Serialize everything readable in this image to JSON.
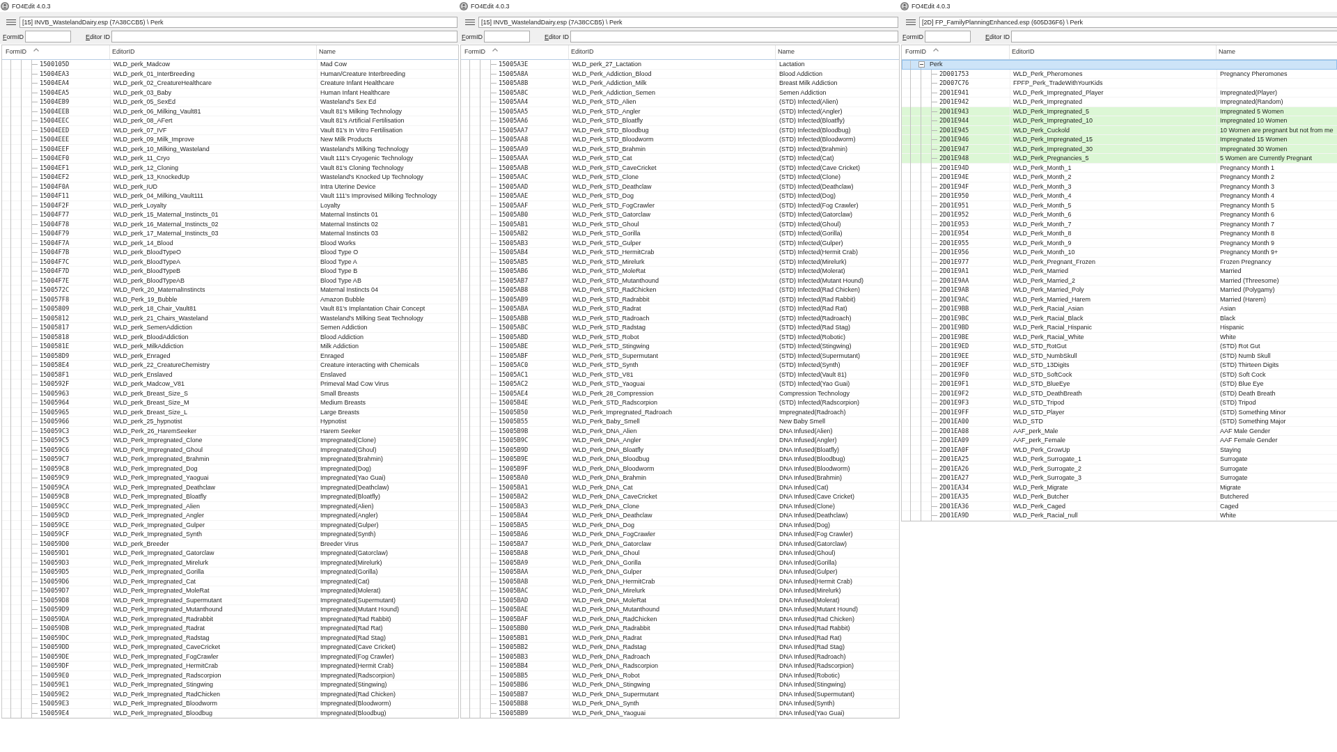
{
  "windows": [
    {
      "title": "FO4Edit 4.0.3",
      "path": "[15] INVB_WastelandDairy.esp (7A38CCB5) \\ Perk",
      "filters": [
        {
          "label": "FormID"
        },
        {
          "label": "Editor ID"
        }
      ],
      "columns": [
        {
          "label": "FormID",
          "sorted": true
        },
        {
          "label": "EditorID",
          "sorted": false
        },
        {
          "label": "Name",
          "sorted": false
        }
      ],
      "tree": [
        {
          "cells": [
            "1500105D",
            "WLD_perk_Madcow",
            "Mad Cow"
          ],
          "selected": false
        },
        {
          "cells": [
            "15004EA3",
            "WLD_perk_01_InterBreeding",
            "Human/Creature Interbreeding"
          ],
          "selected": false
        },
        {
          "cells": [
            "15004EA4",
            "WLD_perk_02_CreatureHealthcare",
            "Creature Infant Healthcare"
          ],
          "selected": false
        },
        {
          "cells": [
            "15004EA5",
            "WLD_perk_03_Baby",
            "Human Infant Healthcare"
          ],
          "selected": false
        },
        {
          "cells": [
            "15004EB9",
            "WLD_perk_05_SexEd",
            "Wasteland's Sex Ed"
          ],
          "selected": false
        },
        {
          "cells": [
            "15004EEB",
            "WLD_perk_06_Milking_Vault81",
            "Vault 81's Milking Technology"
          ],
          "selected": false
        },
        {
          "cells": [
            "15004EEC",
            "WLD_perk_08_AFert",
            "Vault 81's Artificial Fertilisation"
          ],
          "selected": false
        },
        {
          "cells": [
            "15004EED",
            "WLD_perk_07_IVF",
            "Vault 81's In Vitro Fertilisation"
          ],
          "selected": false
        },
        {
          "cells": [
            "15004EEE",
            "WLD_perk_09_Milk_Improve",
            "New Milk Products"
          ],
          "selected": false
        },
        {
          "cells": [
            "15004EEF",
            "WLD_perk_10_Milking_Wasteland",
            "Wasteland's Milking Technology"
          ],
          "selected": false
        },
        {
          "cells": [
            "15004EF0",
            "WLD_perk_11_Cryo",
            "Vault 111's Cryogenic Technology"
          ],
          "selected": false
        },
        {
          "cells": [
            "15004EF1",
            "WLD_perk_12_Cloning",
            "Vault 81's Cloning Technology"
          ],
          "selected": false
        },
        {
          "cells": [
            "15004EF2",
            "WLD_perk_13_KnockedUp",
            "Wasteland's Knocked Up Technology"
          ],
          "selected": false
        },
        {
          "cells": [
            "15004F0A",
            "WLD_perk_IUD",
            "Intra Uterine Device"
          ],
          "selected": false
        },
        {
          "cells": [
            "15004F11",
            "WLD_perk_04_Milking_Vault111",
            "Vault 111's Improvised Milking Technology"
          ],
          "selected": false
        },
        {
          "cells": [
            "15004F2F",
            "WLD_perk_Loyalty",
            "Loyalty"
          ],
          "selected": false
        },
        {
          "cells": [
            "15004F77",
            "WLD_perk_15_Maternal_Instincts_01",
            "Maternal Instincts 01"
          ],
          "selected": false
        },
        {
          "cells": [
            "15004F78",
            "WLD_perk_16_Maternal_Instincts_02",
            "Maternal Instincts 02"
          ],
          "selected": false
        },
        {
          "cells": [
            "15004F79",
            "WLD_perk_17_Maternal_Instincts_03",
            "Maternal Instincts 03"
          ],
          "selected": false
        },
        {
          "cells": [
            "15004F7A",
            "WLD_perk_14_Blood",
            "Blood Works"
          ],
          "selected": false
        },
        {
          "cells": [
            "15004F7B",
            "WLD_perk_BloodTypeO",
            "Blood Type O"
          ],
          "selected": false
        },
        {
          "cells": [
            "15004F7C",
            "WLD_perk_BloodTypeA",
            "Blood Type A"
          ],
          "selected": false
        },
        {
          "cells": [
            "15004F7D",
            "WLD_perk_BloodTypeB",
            "Blood Type B"
          ],
          "selected": false
        },
        {
          "cells": [
            "15004F7E",
            "WLD_perk_BloodTypeAB",
            "Blood Type AB"
          ],
          "selected": false
        },
        {
          "cells": [
            "1500572C",
            "WLD_Perk_20_MaternalInstincts",
            "Maternal Instincts 04"
          ],
          "selected": false
        },
        {
          "cells": [
            "150057F8",
            "WLD_Perk_19_Bubble",
            "Amazon Bubble"
          ],
          "selected": false
        },
        {
          "cells": [
            "15005809",
            "WLD_perk_18_Chair_Vault81",
            "Vault 81's Implantation Chair Concept"
          ],
          "selected": false
        },
        {
          "cells": [
            "15005812",
            "WLD_perk_21_Chairs_Wasteland",
            "Wasteland's Milking Seat Technology"
          ],
          "selected": false
        },
        {
          "cells": [
            "15005817",
            "WLD_perk_SemenAddiction",
            "Semen Addiction"
          ],
          "selected": false
        },
        {
          "cells": [
            "15005818",
            "WLD_perk_BloodAddiction",
            "Blood Addiction"
          ],
          "selected": false
        },
        {
          "cells": [
            "1500581E",
            "WLD_perk_MilkAddiction",
            "Milk Addiction"
          ],
          "selected": false
        },
        {
          "cells": [
            "150058D9",
            "WLD_perk_Enraged",
            "Enraged"
          ],
          "selected": false
        },
        {
          "cells": [
            "150058E4",
            "WLD_perk_22_CreatureChemistry",
            "Creature interacting with Chemicals"
          ],
          "selected": false
        },
        {
          "cells": [
            "150058F1",
            "WLD_perk_Enslaved",
            "Enslaved"
          ],
          "selected": false
        },
        {
          "cells": [
            "1500592F",
            "WLD_perk_Madcow_V81",
            "Primeval Mad Cow Virus"
          ],
          "selected": false
        },
        {
          "cells": [
            "15005963",
            "WLD_perk_Breast_Size_S",
            "Small Breasts"
          ],
          "selected": false
        },
        {
          "cells": [
            "15005964",
            "WLD_perk_Breast_Size_M",
            "Medium Breasts"
          ],
          "selected": false
        },
        {
          "cells": [
            "15005965",
            "WLD_perk_Breast_Size_L",
            "Large Breasts"
          ],
          "selected": false
        },
        {
          "cells": [
            "15005966",
            "WLD_perk_25_hypnotist",
            "Hypnotist"
          ],
          "selected": false
        },
        {
          "cells": [
            "150059C3",
            "WLD_Perk_26_HaremSeeker",
            "Harem Seeker"
          ],
          "selected": false
        },
        {
          "cells": [
            "150059C5",
            "WLD_Perk_Impregnated_Clone",
            "Impregnated(Clone)"
          ],
          "selected": false
        },
        {
          "cells": [
            "150059C6",
            "WLD_Perk_Impregnated_Ghoul",
            "Impregnated(Ghoul)"
          ],
          "selected": false
        },
        {
          "cells": [
            "150059C7",
            "WLD_Perk_Impregnated_Brahmin",
            "Impregnated(Brahmin)"
          ],
          "selected": false
        },
        {
          "cells": [
            "150059C8",
            "WLD_Perk_Impregnated_Dog",
            "Impregnated(Dog)"
          ],
          "selected": false
        },
        {
          "cells": [
            "150059C9",
            "WLD_Perk_Impregnated_Yaoguai",
            "Impregnated(Yao Guai)"
          ],
          "selected": false
        },
        {
          "cells": [
            "150059CA",
            "WLD_Perk_Impregnated_Deathclaw",
            "Impregnated(Deathclaw)"
          ],
          "selected": false
        },
        {
          "cells": [
            "150059CB",
            "WLD_Perk_Impregnated_Bloatfly",
            "Impregnated(Bloatfly)"
          ],
          "selected": false
        },
        {
          "cells": [
            "150059CC",
            "WLD_Perk_Impregnated_Alien",
            "Impregnated(Alien)"
          ],
          "selected": false
        },
        {
          "cells": [
            "150059CD",
            "WLD_Perk_Impregnated_Angler",
            "Impregnated(Angler)"
          ],
          "selected": false
        },
        {
          "cells": [
            "150059CE",
            "WLD_Perk_Impregnated_Gulper",
            "Impregnated(Gulper)"
          ],
          "selected": false
        },
        {
          "cells": [
            "150059CF",
            "WLD_Perk_Impregnated_Synth",
            "Impregnated(Synth)"
          ],
          "selected": false
        },
        {
          "cells": [
            "150059D0",
            "WLD_perk_Breeder",
            "Breeder Virus"
          ],
          "selected": false
        },
        {
          "cells": [
            "150059D1",
            "WLD_Perk_Impregnated_Gatorclaw",
            "Impregnated(Gatorclaw)"
          ],
          "selected": false
        },
        {
          "cells": [
            "150059D3",
            "WLD_Perk_Impregnated_Mirelurk",
            "Impregnated(Mirelurk)"
          ],
          "selected": false
        },
        {
          "cells": [
            "150059D5",
            "WLD_Perk_Impregnated_Gorilla",
            "Impregnated(Gorilla)"
          ],
          "selected": false
        },
        {
          "cells": [
            "150059D6",
            "WLD_Perk_Impregnated_Cat",
            "Impregnated(Cat)"
          ],
          "selected": false
        },
        {
          "cells": [
            "150059D7",
            "WLD_Perk_Impregnated_MoleRat",
            "Impregnated(Molerat)"
          ],
          "selected": false
        },
        {
          "cells": [
            "150059D8",
            "WLD_Perk_Impregnated_Supermutant",
            "Impregnated(Supermutant)"
          ],
          "selected": false
        },
        {
          "cells": [
            "150059D9",
            "WLD_Perk_Impregnated_Mutanthound",
            "Impregnated(Mutant Hound)"
          ],
          "selected": false
        },
        {
          "cells": [
            "150059DA",
            "WLD_Perk_Impregnated_Radrabbit",
            "Impregnated(Rad Rabbit)"
          ],
          "selected": false
        },
        {
          "cells": [
            "150059DB",
            "WLD_Perk_Impregnated_Radrat",
            "Impregnated(Rad Rat)"
          ],
          "selected": false
        },
        {
          "cells": [
            "150059DC",
            "WLD_Perk_Impregnated_Radstag",
            "Impregnated(Rad Stag)"
          ],
          "selected": false
        },
        {
          "cells": [
            "150059DD",
            "WLD_Perk_Impregnated_CaveCricket",
            "Impregnated(Cave Cricket)"
          ],
          "selected": false
        },
        {
          "cells": [
            "150059DE",
            "WLD_Perk_Impregnated_FogCrawler",
            "Impregnated(Fog Crawler)"
          ],
          "selected": false
        },
        {
          "cells": [
            "150059DF",
            "WLD_Perk_Impregnated_HermitCrab",
            "Impregnated(Hermit Crab)"
          ],
          "selected": false
        },
        {
          "cells": [
            "150059E0",
            "WLD_Perk_Impregnated_Radscorpion",
            "Impregnated(Radscorpion)"
          ],
          "selected": false
        },
        {
          "cells": [
            "150059E1",
            "WLD_Perk_Impregnated_Stingwing",
            "Impregnated(Stingwing)"
          ],
          "selected": false
        },
        {
          "cells": [
            "150059E2",
            "WLD_Perk_Impregnated_RadChicken",
            "Impregnated(Rad Chicken)"
          ],
          "selected": false
        },
        {
          "cells": [
            "150059E3",
            "WLD_Perk_Impregnated_Bloodworm",
            "Impregnated(Bloodworm)"
          ],
          "selected": false
        },
        {
          "cells": [
            "150059E4",
            "WLD_Perk_Impregnated_Bloodbug",
            "Impregnated(Bloodbug)"
          ],
          "selected": false
        }
      ]
    },
    {
      "title": "FO4Edit 4.0.3",
      "path": "[15] INVB_WastelandDairy.esp (7A38CCB5) \\ Perk",
      "filters": [
        {
          "label": "FormID"
        },
        {
          "label": "Editor ID"
        }
      ],
      "columns": [
        {
          "label": "FormID",
          "sorted": true
        },
        {
          "label": "EditorID",
          "sorted": false
        },
        {
          "label": "Name",
          "sorted": false
        }
      ],
      "tree": [
        {
          "cells": [
            "15005A3E",
            "WLD_perk_27_Lactation",
            "Lactation"
          ],
          "selected": false
        },
        {
          "cells": [
            "15005A8A",
            "WLD_Perk_Addiction_Blood",
            "Blood Addiction"
          ],
          "selected": false
        },
        {
          "cells": [
            "15005A8B",
            "WLD_Perk_Addiction_Milk",
            "Breast Milk Addiction"
          ],
          "selected": false
        },
        {
          "cells": [
            "15005A8C",
            "WLD_Perk_Addiction_Semen",
            "Semen Addiction"
          ],
          "selected": false
        },
        {
          "cells": [
            "15005AA4",
            "WLD_Perk_STD_Alien",
            "(STD) Infected(Alien)"
          ],
          "selected": false
        },
        {
          "cells": [
            "15005AA5",
            "WLD_Perk_STD_Angler",
            "(STD) Infected(Angler)"
          ],
          "selected": false
        },
        {
          "cells": [
            "15005AA6",
            "WLD_Perk_STD_Bloatfly",
            "(STD) Infected(Bloatfly)"
          ],
          "selected": false
        },
        {
          "cells": [
            "15005AA7",
            "WLD_Perk_STD_Bloodbug",
            "(STD) Infected(Bloodbug)"
          ],
          "selected": false
        },
        {
          "cells": [
            "15005AA8",
            "WLD_Perk_STD_Bloodworm",
            "(STD) Infected(Bloodworm)"
          ],
          "selected": false
        },
        {
          "cells": [
            "15005AA9",
            "WLD_Perk_STD_Brahmin",
            "(STD) Infected(Brahmin)"
          ],
          "selected": false
        },
        {
          "cells": [
            "15005AAA",
            "WLD_Perk_STD_Cat",
            "(STD) Infected(Cat)"
          ],
          "selected": false
        },
        {
          "cells": [
            "15005AAB",
            "WLD_Perk_STD_CaveCricket",
            "(STD) Infected(Cave Cricket)"
          ],
          "selected": false
        },
        {
          "cells": [
            "15005AAC",
            "WLD_Perk_STD_Clone",
            "(STD) Infected(Clone)"
          ],
          "selected": false
        },
        {
          "cells": [
            "15005AAD",
            "WLD_Perk_STD_Deathclaw",
            "(STD) Infected(Deathclaw)"
          ],
          "selected": false
        },
        {
          "cells": [
            "15005AAE",
            "WLD_Perk_STD_Dog",
            "(STD) Infected(Dog)"
          ],
          "selected": false
        },
        {
          "cells": [
            "15005AAF",
            "WLD_Perk_STD_FogCrawler",
            "(STD) Infected(Fog Crawler)"
          ],
          "selected": false
        },
        {
          "cells": [
            "15005AB0",
            "WLD_Perk_STD_Gatorclaw",
            "(STD) Infected(Gatorclaw)"
          ],
          "selected": false
        },
        {
          "cells": [
            "15005AB1",
            "WLD_Perk_STD_Ghoul",
            "(STD) Infected(Ghoul)"
          ],
          "selected": false
        },
        {
          "cells": [
            "15005AB2",
            "WLD_Perk_STD_Gorilla",
            "(STD) Infected(Gorilla)"
          ],
          "selected": false
        },
        {
          "cells": [
            "15005AB3",
            "WLD_Perk_STD_Gulper",
            "(STD) Infected(Gulper)"
          ],
          "selected": false
        },
        {
          "cells": [
            "15005AB4",
            "WLD_Perk_STD_HermitCrab",
            "(STD) Infected(Hermit Crab)"
          ],
          "selected": false
        },
        {
          "cells": [
            "15005AB5",
            "WLD_Perk_STD_Mirelurk",
            "(STD) Infected(Mirelurk)"
          ],
          "selected": false
        },
        {
          "cells": [
            "15005AB6",
            "WLD_Perk_STD_MoleRat",
            "(STD) Infected(Molerat)"
          ],
          "selected": false
        },
        {
          "cells": [
            "15005AB7",
            "WLD_Perk_STD_Mutanthound",
            "(STD) Infected(Mutant Hound)"
          ],
          "selected": false
        },
        {
          "cells": [
            "15005AB8",
            "WLD_Perk_STD_RadChicken",
            "(STD) Infected(Rad Chicken)"
          ],
          "selected": false
        },
        {
          "cells": [
            "15005AB9",
            "WLD_Perk_STD_Radrabbit",
            "(STD) Infected(Rad Rabbit)"
          ],
          "selected": false
        },
        {
          "cells": [
            "15005ABA",
            "WLD_Perk_STD_Radrat",
            "(STD) Infected(Rad Rat)"
          ],
          "selected": false
        },
        {
          "cells": [
            "15005ABB",
            "WLD_Perk_STD_Radroach",
            "(STD) Infected(Radroach)"
          ],
          "selected": false
        },
        {
          "cells": [
            "15005ABC",
            "WLD_Perk_STD_Radstag",
            "(STD) Infected(Rad Stag)"
          ],
          "selected": false
        },
        {
          "cells": [
            "15005ABD",
            "WLD_Perk_STD_Robot",
            "(STD) Infected(Robotic)"
          ],
          "selected": false
        },
        {
          "cells": [
            "15005ABE",
            "WLD_Perk_STD_Stingwing",
            "(STD) Infected(Stingwing)"
          ],
          "selected": false
        },
        {
          "cells": [
            "15005ABF",
            "WLD_Perk_STD_Supermutant",
            "(STD) Infected(Supermutant)"
          ],
          "selected": false
        },
        {
          "cells": [
            "15005AC0",
            "WLD_Perk_STD_Synth",
            "(STD) Infected(Synth)"
          ],
          "selected": false
        },
        {
          "cells": [
            "15005AC1",
            "WLD_Perk_STD_V81",
            "(STD) Infected(Vault 81)"
          ],
          "selected": false
        },
        {
          "cells": [
            "15005AC2",
            "WLD_Perk_STD_Yaoguai",
            "(STD) Infected(Yao Guai)"
          ],
          "selected": false
        },
        {
          "cells": [
            "15005AE4",
            "WLD_Perk_28_Compression",
            "Compression Technology"
          ],
          "selected": false
        },
        {
          "cells": [
            "15005B4E",
            "WLD_Perk_STD_Radscorpion",
            "(STD) Infected(Radscorpion)"
          ],
          "selected": false
        },
        {
          "cells": [
            "15005B50",
            "WLD_Perk_Impregnated_Radroach",
            "Impregnated(Radroach)"
          ],
          "selected": false
        },
        {
          "cells": [
            "15005B55",
            "WLD_Perk_Baby_Smell",
            "New Baby Smell"
          ],
          "selected": false
        },
        {
          "cells": [
            "15005B9B",
            "WLD_Perk_DNA_Alien",
            "DNA Infused(Alien)"
          ],
          "selected": false
        },
        {
          "cells": [
            "15005B9C",
            "WLD_Perk_DNA_Angler",
            "DNA Infused(Angler)"
          ],
          "selected": false
        },
        {
          "cells": [
            "15005B9D",
            "WLD_Perk_DNA_Bloatfly",
            "DNA Infused(Bloatfly)"
          ],
          "selected": false
        },
        {
          "cells": [
            "15005B9E",
            "WLD_Perk_DNA_Bloodbug",
            "DNA Infused(Bloodbug)"
          ],
          "selected": false
        },
        {
          "cells": [
            "15005B9F",
            "WLD_Perk_DNA_Bloodworm",
            "DNA Infused(Bloodworm)"
          ],
          "selected": false
        },
        {
          "cells": [
            "15005BA0",
            "WLD_Perk_DNA_Brahmin",
            "DNA Infused(Brahmin)"
          ],
          "selected": false
        },
        {
          "cells": [
            "15005BA1",
            "WLD_Perk_DNA_Cat",
            "DNA Infused(Cat)"
          ],
          "selected": false
        },
        {
          "cells": [
            "15005BA2",
            "WLD_Perk_DNA_CaveCricket",
            "DNA Infused(Cave Cricket)"
          ],
          "selected": false
        },
        {
          "cells": [
            "15005BA3",
            "WLD_Perk_DNA_Clone",
            "DNA Infused(Clone)"
          ],
          "selected": false
        },
        {
          "cells": [
            "15005BA4",
            "WLD_Perk_DNA_Deathclaw",
            "DNA Infused(Deathclaw)"
          ],
          "selected": false
        },
        {
          "cells": [
            "15005BA5",
            "WLD_Perk_DNA_Dog",
            "DNA Infused(Dog)"
          ],
          "selected": false
        },
        {
          "cells": [
            "15005BA6",
            "WLD_Perk_DNA_FogCrawler",
            "DNA Infused(Fog Crawler)"
          ],
          "selected": false
        },
        {
          "cells": [
            "15005BA7",
            "WLD_Perk_DNA_Gatorclaw",
            "DNA Infused(Gatorclaw)"
          ],
          "selected": false
        },
        {
          "cells": [
            "15005BA8",
            "WLD_Perk_DNA_Ghoul",
            "DNA Infused(Ghoul)"
          ],
          "selected": false
        },
        {
          "cells": [
            "15005BA9",
            "WLD_Perk_DNA_Gorilla",
            "DNA Infused(Gorilla)"
          ],
          "selected": false
        },
        {
          "cells": [
            "15005BAA",
            "WLD_Perk_DNA_Gulper",
            "DNA Infused(Gulper)"
          ],
          "selected": false
        },
        {
          "cells": [
            "15005BAB",
            "WLD_Perk_DNA_HermitCrab",
            "DNA Infused(Hermit Crab)"
          ],
          "selected": false
        },
        {
          "cells": [
            "15005BAC",
            "WLD_Perk_DNA_Mirelurk",
            "DNA Infused(Mirelurk)"
          ],
          "selected": false
        },
        {
          "cells": [
            "15005BAD",
            "WLD_Perk_DNA_MoleRat",
            "DNA Infused(Molerat)"
          ],
          "selected": false
        },
        {
          "cells": [
            "15005BAE",
            "WLD_Perk_DNA_Mutanthound",
            "DNA Infused(Mutant Hound)"
          ],
          "selected": false
        },
        {
          "cells": [
            "15005BAF",
            "WLD_Perk_DNA_RadChicken",
            "DNA Infused(Rad Chicken)"
          ],
          "selected": false
        },
        {
          "cells": [
            "15005BB0",
            "WLD_Perk_DNA_Radrabbit",
            "DNA Infused(Rad Rabbit)"
          ],
          "selected": false
        },
        {
          "cells": [
            "15005BB1",
            "WLD_Perk_DNA_Radrat",
            "DNA Infused(Rad Rat)"
          ],
          "selected": false
        },
        {
          "cells": [
            "15005BB2",
            "WLD_Perk_DNA_Radstag",
            "DNA Infused(Rad Stag)"
          ],
          "selected": false
        },
        {
          "cells": [
            "15005BB3",
            "WLD_Perk_DNA_Radroach",
            "DNA Infused(Radroach)"
          ],
          "selected": false
        },
        {
          "cells": [
            "15005BB4",
            "WLD_Perk_DNA_Radscorpion",
            "DNA Infused(Radscorpion)"
          ],
          "selected": false
        },
        {
          "cells": [
            "15005BB5",
            "WLD_Perk_DNA_Robot",
            "DNA Infused(Robotic)"
          ],
          "selected": false
        },
        {
          "cells": [
            "15005BB6",
            "WLD_Perk_DNA_Stingwing",
            "DNA Infused(Stingwing)"
          ],
          "selected": false
        },
        {
          "cells": [
            "15005BB7",
            "WLD_Perk_DNA_Supermutant",
            "DNA Infused(Supermutant)"
          ],
          "selected": false
        },
        {
          "cells": [
            "15005BB8",
            "WLD_Perk_DNA_Synth",
            "DNA Infused(Synth)"
          ],
          "selected": false
        },
        {
          "cells": [
            "15005BB9",
            "WLD_Perk_DNA_Yaoguai",
            "DNA Infused(Yao Guai)"
          ],
          "selected": false
        }
      ]
    },
    {
      "title": "FO4Edit 4.0.3",
      "path": "[2D] FP_FamilyPlanningEnhanced.esp (605D36F6) \\ Perk",
      "filters": [
        {
          "label": "FormID"
        },
        {
          "label": "Editor ID"
        }
      ],
      "columns": [
        {
          "label": "FormID",
          "sorted": true
        },
        {
          "label": "EditorID",
          "sorted": false
        },
        {
          "label": "Name",
          "sorted": false
        }
      ],
      "tree": [
        {
          "label": "Perk",
          "expanded": true,
          "selected": true,
          "children": [
            {
              "cells": [
                "2D001753",
                "WLD_Perk_Pheromones",
                "Pregnancy Pheromones"
              ],
              "selected": false,
              "highlighted": false
            },
            {
              "cells": [
                "2D007C76",
                "FPFP_Perk_TradeWithYourKids"
              ],
              "selected": false,
              "highlighted": false
            },
            {
              "cells": [
                "2D01E941",
                "WLD_Perk_Impregnated_Player",
                "Impregnated(Player)"
              ],
              "selected": false,
              "highlighted": false
            },
            {
              "cells": [
                "2D01E942",
                "WLD_Perk_Impregnated",
                "Impregnated(Random)"
              ],
              "selected": false,
              "highlighted": false
            },
            {
              "cells": [
                "2D01E943",
                "WLD_Perk_Impregnated_5",
                "Impregnated 5 Women"
              ],
              "selected": false,
              "highlighted": true
            },
            {
              "cells": [
                "2D01E944",
                "WLD_Perk_Impregnated_10",
                "Impregnated 10 Women"
              ],
              "selected": false,
              "highlighted": true
            },
            {
              "cells": [
                "2D01E945",
                "WLD_Perk_Cuckold",
                "10 Women are pregnant but not from me"
              ],
              "selected": false,
              "highlighted": true
            },
            {
              "cells": [
                "2D01E946",
                "WLD_Perk_Impregnated_15",
                "Impregnated 15 Women"
              ],
              "selected": false,
              "highlighted": true
            },
            {
              "cells": [
                "2D01E947",
                "WLD_Perk_Impregnated_30",
                "Impregnated 30 Women"
              ],
              "selected": false,
              "highlighted": true
            },
            {
              "cells": [
                "2D01E948",
                "WLD_Perk_Pregnancies_5",
                "5 Women are Currently Pregnant"
              ],
              "selected": false,
              "highlighted": true
            },
            {
              "cells": [
                "2D01E94D",
                "WLD_Perk_Month_1",
                "Pregnancy Month 1"
              ],
              "selected": false,
              "highlighted": false
            },
            {
              "cells": [
                "2D01E94E",
                "WLD_Perk_Month_2",
                "Pregnancy Month 2"
              ],
              "selected": false,
              "highlighted": false
            },
            {
              "cells": [
                "2D01E94F",
                "WLD_Perk_Month_3",
                "Pregnancy Month 3"
              ],
              "selected": false,
              "highlighted": false
            },
            {
              "cells": [
                "2D01E950",
                "WLD_Perk_Month_4",
                "Pregnancy Month 4"
              ],
              "selected": false,
              "highlighted": false
            },
            {
              "cells": [
                "2D01E951",
                "WLD_Perk_Month_5",
                "Pregnancy Month 5"
              ],
              "selected": false,
              "highlighted": false
            },
            {
              "cells": [
                "2D01E952",
                "WLD_Perk_Month_6",
                "Pregnancy Month 6"
              ],
              "selected": false,
              "highlighted": false
            },
            {
              "cells": [
                "2D01E953",
                "WLD_Perk_Month_7",
                "Pregnancy Month 7"
              ],
              "selected": false,
              "highlighted": false
            },
            {
              "cells": [
                "2D01E954",
                "WLD_Perk_Month_8",
                "Pregnancy Month 8"
              ],
              "selected": false,
              "highlighted": false
            },
            {
              "cells": [
                "2D01E955",
                "WLD_Perk_Month_9",
                "Pregnancy Month 9"
              ],
              "selected": false,
              "highlighted": false
            },
            {
              "cells": [
                "2D01E956",
                "WLD_Perk_Month_10",
                "Pregnancy Month 9+"
              ],
              "selected": false,
              "highlighted": false
            },
            {
              "cells": [
                "2D01E977",
                "WLD_Perk_Pregnant_Frozen",
                "Frozen Pregnancy"
              ],
              "selected": false,
              "highlighted": false
            },
            {
              "cells": [
                "2D01E9A1",
                "WLD_Perk_Married",
                "Married"
              ],
              "selected": false,
              "highlighted": false
            },
            {
              "cells": [
                "2D01E9AA",
                "WLD_Perk_Married_2",
                "Married (Threesome)"
              ],
              "selected": false,
              "highlighted": false
            },
            {
              "cells": [
                "2D01E9AB",
                "WLD_Perk_Married_Poly",
                "Married (Polygamy)"
              ],
              "selected": false,
              "highlighted": false
            },
            {
              "cells": [
                "2D01E9AC",
                "WLD_Perk_Married_Harem",
                "Married (Harem)"
              ],
              "selected": false,
              "highlighted": false
            },
            {
              "cells": [
                "2D01E9BB",
                "WLD_Perk_Racial_Asian",
                "Asian"
              ],
              "selected": false,
              "highlighted": false
            },
            {
              "cells": [
                "2D01E9BC",
                "WLD_Perk_Racial_Black",
                "Black"
              ],
              "selected": false,
              "highlighted": false
            },
            {
              "cells": [
                "2D01E9BD",
                "WLD_Perk_Racial_Hispanic",
                "Hispanic"
              ],
              "selected": false,
              "highlighted": false
            },
            {
              "cells": [
                "2D01E9BE",
                "WLD_Perk_Racial_White",
                "White"
              ],
              "selected": false,
              "highlighted": false
            },
            {
              "cells": [
                "2D01E9ED",
                "WLD_STD_RotGut",
                "(STD) Rot Gut"
              ],
              "selected": false,
              "highlighted": false
            },
            {
              "cells": [
                "2D01E9EE",
                "WLD_STD_NumbSkull",
                "(STD) Numb Skull"
              ],
              "selected": false,
              "highlighted": false
            },
            {
              "cells": [
                "2D01E9EF",
                "WLD_STD_13Digits",
                "(STD) Thirteen Digits"
              ],
              "selected": false,
              "highlighted": false
            },
            {
              "cells": [
                "2D01E9F0",
                "WLD_STD_SoftCock",
                "(STD) Soft Cock"
              ],
              "selected": false,
              "highlighted": false
            },
            {
              "cells": [
                "2D01E9F1",
                "WLD_STD_BlueEye",
                "(STD) Blue Eye"
              ],
              "selected": false,
              "highlighted": false
            },
            {
              "cells": [
                "2D01E9F2",
                "WLD_STD_DeathBreath",
                "(STD) Death Breath"
              ],
              "selected": false,
              "highlighted": false
            },
            {
              "cells": [
                "2D01E9F3",
                "WLD_STD_Tripod",
                "(STD) Tripod"
              ],
              "selected": false,
              "highlighted": false
            },
            {
              "cells": [
                "2D01E9FF",
                "WLD_STD_Player",
                "(STD) Something Minor"
              ],
              "selected": false,
              "highlighted": false
            },
            {
              "cells": [
                "2D01EA00",
                "WLD_STD",
                "(STD) Something Major"
              ],
              "selected": false,
              "highlighted": false
            },
            {
              "cells": [
                "2D01EA08",
                "AAF_perk_Male",
                "AAF Male Gender"
              ],
              "selected": false,
              "highlighted": false
            },
            {
              "cells": [
                "2D01EA09",
                "AAF_perk_Female",
                "AAF Female Gender"
              ],
              "selected": false,
              "highlighted": false
            },
            {
              "cells": [
                "2D01EA0F",
                "WLD_Perk_GrowUp",
                "Staying"
              ],
              "selected": false,
              "highlighted": false
            },
            {
              "cells": [
                "2D01EA25",
                "WLD_Perk_Surrogate_1",
                "Surrogate"
              ],
              "selected": false,
              "highlighted": false
            },
            {
              "cells": [
                "2D01EA26",
                "WLD_Perk_Surrogate_2",
                "Surrogate"
              ],
              "selected": false,
              "highlighted": false
            },
            {
              "cells": [
                "2D01EA27",
                "WLD_Perk_Surrogate_3",
                "Surrogate"
              ],
              "selected": false,
              "highlighted": false
            },
            {
              "cells": [
                "2D01EA34",
                "WLD_Perk_Migrate",
                "Migrate"
              ],
              "selected": false,
              "highlighted": false
            },
            {
              "cells": [
                "2D01EA35",
                "WLD_Perk_Butcher",
                "Butchered"
              ],
              "selected": false,
              "highlighted": false
            },
            {
              "cells": [
                "2D01EA36",
                "WLD_Perk_Caged",
                "Caged"
              ],
              "selected": false,
              "highlighted": false
            },
            {
              "cells": [
                "2D01EA9D",
                "WLD_Perk_Racial_null",
                "White"
              ],
              "selected": false,
              "highlighted": false
            }
          ]
        }
      ]
    }
  ]
}
